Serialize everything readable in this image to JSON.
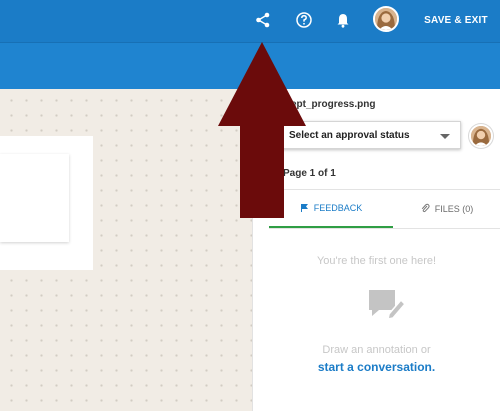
{
  "topbar": {
    "save_exit_label": "SAVE & EXIT"
  },
  "file": {
    "name": "ept_progress.png"
  },
  "approval": {
    "selected": "Select an approval status"
  },
  "page_info": "Page 1 of 1",
  "tabs": {
    "feedback": "FEEDBACK",
    "files": "FILES (0)"
  },
  "empty_state": {
    "first_line": "You're the first one here!",
    "draw_line": "Draw an annotation or",
    "link": "start a conversation."
  },
  "colors": {
    "topbar": "#1b7cc7",
    "link": "#1b7cc7",
    "tab_underline": "#2f9e44",
    "arrow": "#6b0b0b"
  },
  "icons": [
    "share-icon",
    "help-icon",
    "bell-icon",
    "chat-icon",
    "flag-icon",
    "paperclip-icon",
    "big-red-arrow"
  ]
}
